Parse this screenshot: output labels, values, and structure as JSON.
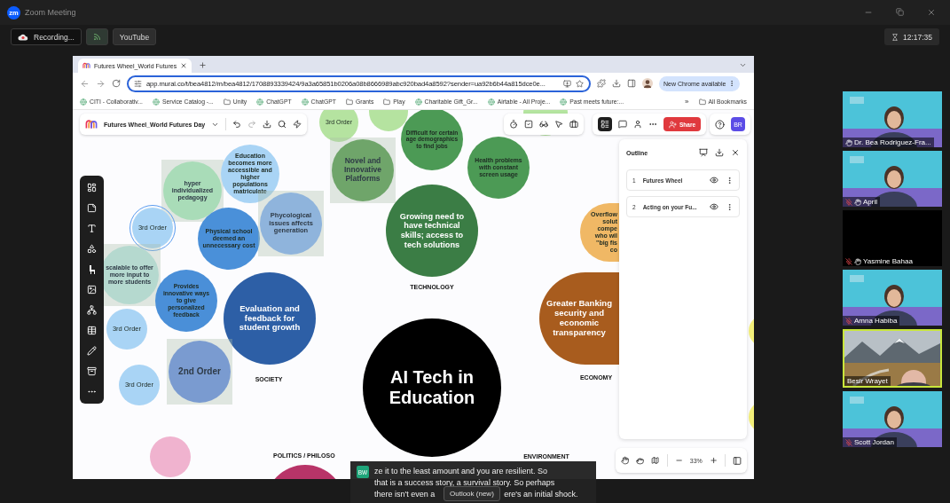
{
  "window": {
    "app_badge": "zm",
    "title": "Zoom Meeting"
  },
  "meeting_bar": {
    "recording": "Recording...",
    "stream": "YouTube",
    "timer": "12:17:35"
  },
  "browser": {
    "tabs": [
      {
        "title": "Futures Wheel_World Futures",
        "selected": true
      }
    ],
    "url": "app.mural.co/t/bea4812/m/bea4812/1708893339424/9a3a65851b0206a08b8666989abc920bad4a8592?sender=ua92b6b44a815dce0e...",
    "update_button": "New Chrome available",
    "bookmarks": [
      {
        "label": "CITI - Collaborativ...",
        "kind": "site"
      },
      {
        "label": "Service Catalog -...",
        "kind": "site"
      },
      {
        "label": "Unity",
        "kind": "folder"
      },
      {
        "label": "ChatGPT",
        "kind": "site"
      },
      {
        "label": "ChatGPT",
        "kind": "site"
      },
      {
        "label": "Grants",
        "kind": "folder"
      },
      {
        "label": "Play",
        "kind": "folder"
      },
      {
        "label": "Charitable Gift_Gr...",
        "kind": "site"
      },
      {
        "label": "Airtable - All Proje...",
        "kind": "site"
      },
      {
        "label": "Past meets future:...",
        "kind": "site"
      }
    ],
    "more_bookmarks": "»",
    "all_bookmarks": "All Bookmarks"
  },
  "mural": {
    "board_title": "Futures Wheel_World Futures Day",
    "share": "Share",
    "user": "BR",
    "nodes": [
      {
        "text": "3rd Order",
        "color": "#b5e3a0",
        "framed": false,
        "selected": false
      },
      {
        "color": "#b5e3a0",
        "framed": false,
        "selected": false
      },
      {
        "color": "#b5e5a0",
        "framed": false,
        "selected": false
      },
      {
        "text": "Difficult for certain age demographics to find jobs",
        "color": "#4c9a55",
        "framed": false,
        "selected": false
      },
      {
        "text": "hyper individualized pedagogy",
        "color": "#a9dcb8",
        "framed": true,
        "selected": false
      },
      {
        "text": "Education becomes more accessible and higher populations matriculate",
        "color": "#a9d4f5",
        "framed": false,
        "selected": false
      },
      {
        "text": "Novel and Innovative Platforms",
        "color": "#6fa56a",
        "framed": true,
        "selected": false
      },
      {
        "text": "Health problems with constant screen usage",
        "color": "#4c9a55",
        "framed": false,
        "selected": false
      },
      {
        "text": "3rd Order",
        "color": "#a9d4f5",
        "framed": false,
        "selected": true
      },
      {
        "text": "Physical school deemed an unnecessary cost",
        "color": "#4a90d9",
        "framed": false,
        "selected": false
      },
      {
        "text": "Phycological issues affects generation",
        "color": "#8fb4dc",
        "framed": true,
        "selected": false
      },
      {
        "text": "Growing need to have technical skills; access to tech solutions",
        "color": "#3b7d45",
        "framed": false,
        "selected": false
      },
      {
        "text": "Overflow\nsolut\ncompe\nwho wil\n\"big fis\nco",
        "color": "#f0b865",
        "framed": false,
        "selected": false
      },
      {
        "text": "scalable to offer more input to more students",
        "color": "#b5d9cf",
        "framed": true,
        "selected": false
      },
      {
        "text": "Provides innovative ways to give personalized feedback",
        "color": "#4a8fd8",
        "framed": false,
        "selected": false
      },
      {
        "text": "3rd Order",
        "color": "#a9d4f5",
        "framed": false,
        "selected": false
      },
      {
        "text": "Evaluation and feedback for student growth",
        "color": "#2d5fa6",
        "framed": false,
        "selected": false
      },
      {
        "text": "Greater Banking security and economic transparency",
        "color": "#a85c1e",
        "framed": false,
        "selected": false
      },
      {
        "color": "#f3ef7a",
        "framed": false,
        "selected": false
      },
      {
        "text": "3rd Order",
        "color": "#a9d4f5",
        "framed": false,
        "selected": false
      },
      {
        "text": "2nd Order",
        "color": "#7a9bd0",
        "framed": true,
        "selected": false
      },
      {
        "text": "AI Tech in Education",
        "color": "#000000",
        "framed": false,
        "selected": false
      },
      {
        "color": "#f3ef7a",
        "framed": false,
        "selected": false
      },
      {
        "color": "#f0b3cf",
        "framed": false,
        "selected": false
      },
      {
        "color": "#b83468",
        "framed": false,
        "selected": false
      }
    ],
    "labels": [
      "SOCIETY",
      "TECHNOLOGY",
      "ECONOMY",
      "POLITICS / PHILOSO",
      "ENVIRONMENT"
    ],
    "outline": {
      "title": "Outline",
      "items": [
        {
          "number": "1",
          "title": "Futures Wheel"
        },
        {
          "number": "2",
          "title": "Acting on your Fu..."
        }
      ]
    },
    "zoom": "33%"
  },
  "caption": {
    "speaker": "BW",
    "lines": [
      "ze it to the least amount and you are resilient. So",
      "that is a success story, a survival story. So perhaps",
      "there isn't even a",
      "ere's an initial shock."
    ]
  },
  "tooltip": "Outlook (new)",
  "participants": [
    {
      "name": "Dr. Bea Rodriguez-Fra...",
      "kind": "branded",
      "muted": false,
      "hand_raised": true,
      "speaking": false
    },
    {
      "name": "April",
      "kind": "branded",
      "muted": true,
      "hand_raised": true,
      "speaking": false
    },
    {
      "name": "Yasmine Bahaa",
      "kind": "off",
      "muted": true,
      "hand_raised": true,
      "speaking": false
    },
    {
      "name": "Amna Habiba",
      "kind": "branded",
      "muted": true,
      "hand_raised": false,
      "speaking": false
    },
    {
      "name": "Besir Wrayet",
      "kind": "landscape",
      "muted": false,
      "hand_raised": false,
      "speaking": true
    },
    {
      "name": "Scott Jordan",
      "kind": "branded",
      "muted": true,
      "hand_raised": false,
      "speaking": false
    }
  ]
}
